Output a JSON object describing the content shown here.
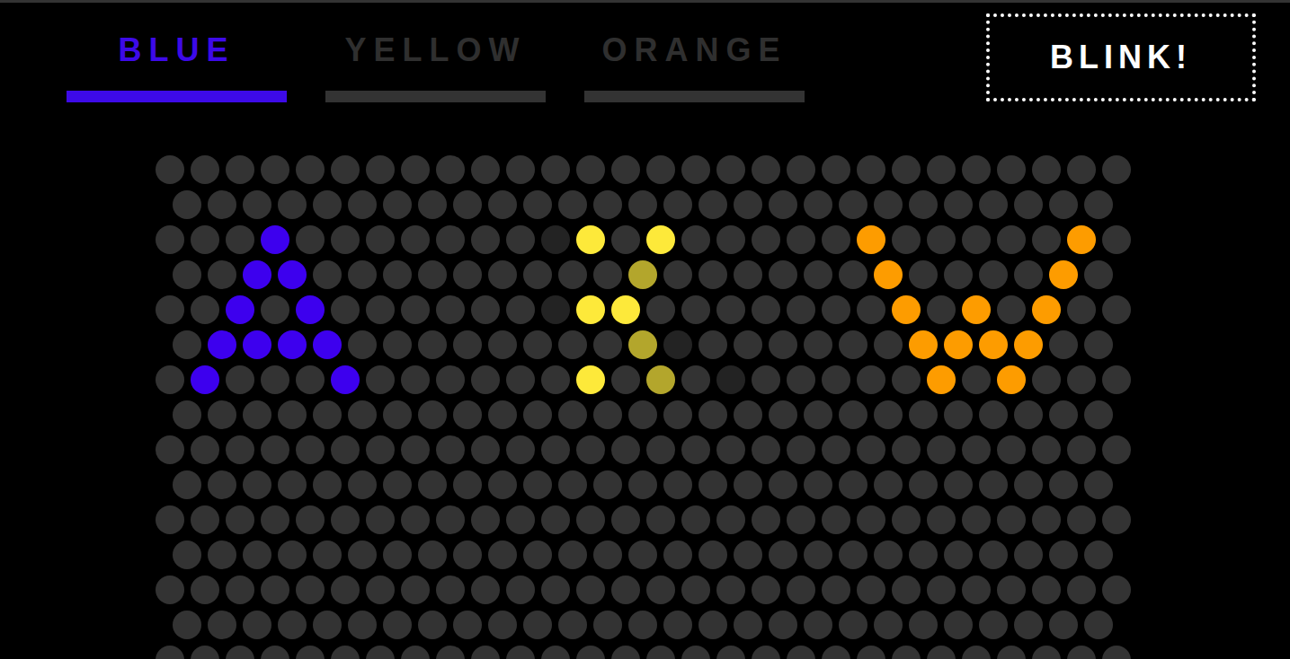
{
  "tabs": [
    {
      "label": "BLUE",
      "selected": true
    },
    {
      "label": "YELLOW",
      "selected": false
    },
    {
      "label": "ORANGE",
      "selected": false
    }
  ],
  "button": {
    "label": "BLINK!"
  },
  "matrix": {
    "rows": [
      [
        "#333333",
        "#333333",
        "#333333",
        "#333333",
        "#333333",
        "#333333",
        "#333333",
        "#333333",
        "#333333",
        "#333333",
        "#333333",
        "#333333",
        "#333333",
        "#333333",
        "#333333",
        "#333333",
        "#333333",
        "#333333",
        "#333333",
        "#333333",
        "#333333",
        "#333333",
        "#333333",
        "#333333",
        "#333333",
        "#333333",
        "#333333",
        "#333333"
      ],
      [
        "#333333",
        "#333333",
        "#333333",
        "#333333",
        "#333333",
        "#333333",
        "#333333",
        "#333333",
        "#333333",
        "#333333",
        "#333333",
        "#333333",
        "#333333",
        "#333333",
        "#333333",
        "#333333",
        "#333333",
        "#333333",
        "#333333",
        "#333333",
        "#333333",
        "#333333",
        "#333333",
        "#333333",
        "#333333",
        "#333333",
        "#333333"
      ],
      [
        "#333333",
        "#333333",
        "#333333",
        "#3d00ee",
        "#333333",
        "#333333",
        "#333333",
        "#333333",
        "#333333",
        "#333333",
        "#333333",
        "#232323",
        "#fde93a",
        "#333333",
        "#fde93a",
        "#333333",
        "#333333",
        "#333333",
        "#333333",
        "#333333",
        "#fd9c00",
        "#333333",
        "#333333",
        "#333333",
        "#333333",
        "#333333",
        "#fd9c00",
        "#333333"
      ],
      [
        "#333333",
        "#333333",
        "#3d00ee",
        "#3d00ee",
        "#333333",
        "#333333",
        "#333333",
        "#333333",
        "#333333",
        "#333333",
        "#333333",
        "#333333",
        "#333333",
        "#b3a62c",
        "#333333",
        "#333333",
        "#333333",
        "#333333",
        "#333333",
        "#333333",
        "#fd9c00",
        "#333333",
        "#333333",
        "#333333",
        "#333333",
        "#fd9c00",
        "#333333"
      ],
      [
        "#333333",
        "#333333",
        "#3d00ee",
        "#333333",
        "#3d00ee",
        "#333333",
        "#333333",
        "#333333",
        "#333333",
        "#333333",
        "#333333",
        "#232323",
        "#fde93a",
        "#fde93a",
        "#333333",
        "#333333",
        "#333333",
        "#333333",
        "#333333",
        "#333333",
        "#333333",
        "#fd9c00",
        "#333333",
        "#fd9c00",
        "#333333",
        "#fd9c00",
        "#333333",
        "#333333"
      ],
      [
        "#333333",
        "#3d00ee",
        "#3d00ee",
        "#3d00ee",
        "#3d00ee",
        "#333333",
        "#333333",
        "#333333",
        "#333333",
        "#333333",
        "#333333",
        "#333333",
        "#333333",
        "#b3a62c",
        "#232323",
        "#333333",
        "#333333",
        "#333333",
        "#333333",
        "#333333",
        "#333333",
        "#fd9c00",
        "#fd9c00",
        "#fd9c00",
        "#fd9c00",
        "#333333",
        "#333333"
      ],
      [
        "#333333",
        "#3d00ee",
        "#333333",
        "#333333",
        "#333333",
        "#3d00ee",
        "#333333",
        "#333333",
        "#333333",
        "#333333",
        "#333333",
        "#333333",
        "#fde93a",
        "#333333",
        "#b3a62c",
        "#333333",
        "#232323",
        "#333333",
        "#333333",
        "#333333",
        "#333333",
        "#333333",
        "#fd9c00",
        "#333333",
        "#fd9c00",
        "#333333",
        "#333333",
        "#333333"
      ],
      [
        "#333333",
        "#333333",
        "#333333",
        "#333333",
        "#333333",
        "#333333",
        "#333333",
        "#333333",
        "#333333",
        "#333333",
        "#333333",
        "#333333",
        "#333333",
        "#333333",
        "#333333",
        "#333333",
        "#333333",
        "#333333",
        "#333333",
        "#333333",
        "#333333",
        "#333333",
        "#333333",
        "#333333",
        "#333333",
        "#333333",
        "#333333"
      ],
      [
        "#333333",
        "#333333",
        "#333333",
        "#333333",
        "#333333",
        "#333333",
        "#333333",
        "#333333",
        "#333333",
        "#333333",
        "#333333",
        "#333333",
        "#333333",
        "#333333",
        "#333333",
        "#333333",
        "#333333",
        "#333333",
        "#333333",
        "#333333",
        "#333333",
        "#333333",
        "#333333",
        "#333333",
        "#333333",
        "#333333",
        "#333333",
        "#333333"
      ],
      [
        "#333333",
        "#333333",
        "#333333",
        "#333333",
        "#333333",
        "#333333",
        "#333333",
        "#333333",
        "#333333",
        "#333333",
        "#333333",
        "#333333",
        "#333333",
        "#333333",
        "#333333",
        "#333333",
        "#333333",
        "#333333",
        "#333333",
        "#333333",
        "#333333",
        "#333333",
        "#333333",
        "#333333",
        "#333333",
        "#333333",
        "#333333"
      ],
      [
        "#333333",
        "#333333",
        "#333333",
        "#333333",
        "#333333",
        "#333333",
        "#333333",
        "#333333",
        "#333333",
        "#333333",
        "#333333",
        "#333333",
        "#333333",
        "#333333",
        "#333333",
        "#333333",
        "#333333",
        "#333333",
        "#333333",
        "#333333",
        "#333333",
        "#333333",
        "#333333",
        "#333333",
        "#333333",
        "#333333",
        "#333333",
        "#333333"
      ],
      [
        "#333333",
        "#333333",
        "#333333",
        "#333333",
        "#333333",
        "#333333",
        "#333333",
        "#333333",
        "#333333",
        "#333333",
        "#333333",
        "#333333",
        "#333333",
        "#333333",
        "#333333",
        "#333333",
        "#333333",
        "#333333",
        "#333333",
        "#333333",
        "#333333",
        "#333333",
        "#333333",
        "#333333",
        "#333333",
        "#333333",
        "#333333"
      ],
      [
        "#333333",
        "#333333",
        "#333333",
        "#333333",
        "#333333",
        "#333333",
        "#333333",
        "#333333",
        "#333333",
        "#333333",
        "#333333",
        "#333333",
        "#333333",
        "#333333",
        "#333333",
        "#333333",
        "#333333",
        "#333333",
        "#333333",
        "#333333",
        "#333333",
        "#333333",
        "#333333",
        "#333333",
        "#333333",
        "#333333",
        "#333333",
        "#333333"
      ],
      [
        "#333333",
        "#333333",
        "#333333",
        "#333333",
        "#333333",
        "#333333",
        "#333333",
        "#333333",
        "#333333",
        "#333333",
        "#333333",
        "#333333",
        "#333333",
        "#333333",
        "#333333",
        "#333333",
        "#333333",
        "#333333",
        "#333333",
        "#333333",
        "#333333",
        "#333333",
        "#333333",
        "#333333",
        "#333333",
        "#333333",
        "#333333"
      ],
      [
        "#333333",
        "#333333",
        "#333333",
        "#333333",
        "#333333",
        "#333333",
        "#333333",
        "#333333",
        "#333333",
        "#333333",
        "#333333",
        "#333333",
        "#333333",
        "#333333",
        "#333333",
        "#333333",
        "#333333",
        "#333333",
        "#333333",
        "#333333",
        "#333333",
        "#333333",
        "#333333",
        "#333333",
        "#333333",
        "#333333",
        "#333333",
        "#333333"
      ]
    ]
  }
}
